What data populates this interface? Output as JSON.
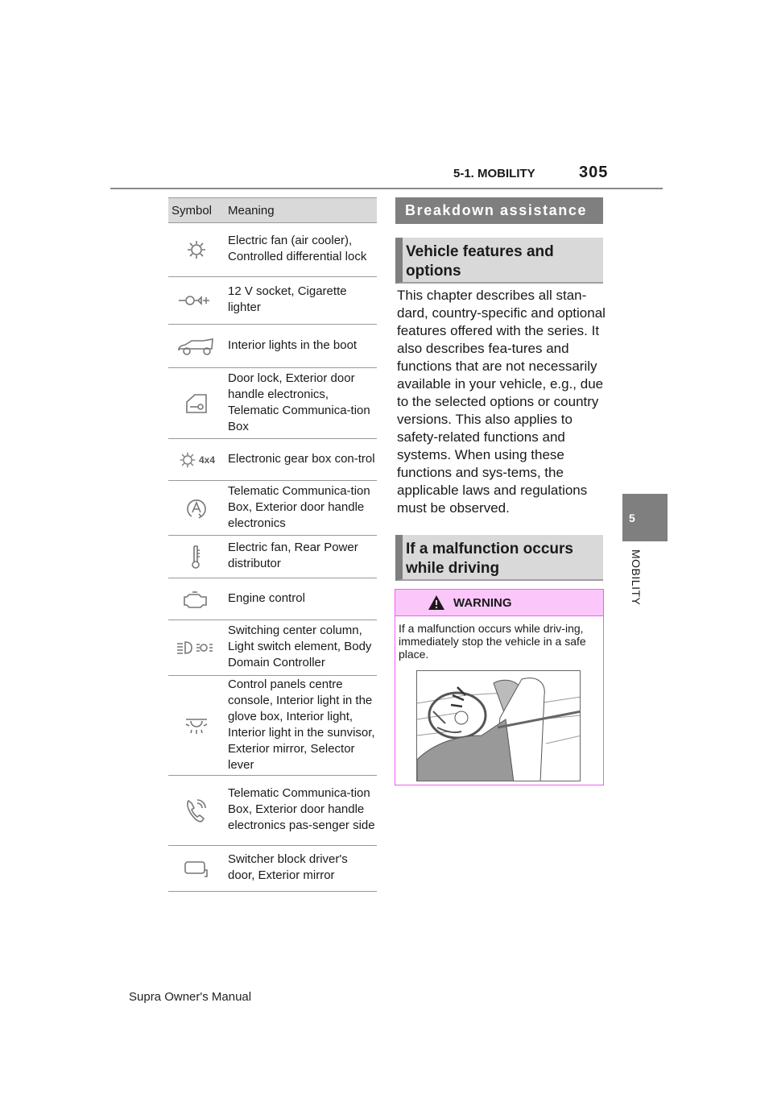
{
  "header": {
    "section": "5-1. MOBILITY",
    "page_number": "305"
  },
  "side_tab": {
    "chapter_number": "5",
    "chapter_label": "MOBILITY"
  },
  "table": {
    "headers": [
      "Symbol",
      "Meaning"
    ],
    "rows": [
      {
        "icon": "gear-icon",
        "meaning": "Electric fan (air cooler), Controlled differential lock"
      },
      {
        "icon": "socket-plug-icon",
        "meaning": "12 V socket, Cigarette lighter"
      },
      {
        "icon": "car-boot-icon",
        "meaning": "Interior lights in the boot"
      },
      {
        "icon": "door-key-icon",
        "meaning": "Door lock, Exterior door handle electronics, Telematic Communica-tion Box"
      },
      {
        "icon": "gear-4x4-icon",
        "icon_text": "4x4",
        "meaning": "Electronic gear box con-trol"
      },
      {
        "icon": "auto-a-icon",
        "icon_text": "A",
        "meaning": "Telematic Communica-tion Box, Exterior door handle electronics"
      },
      {
        "icon": "thermometer-icon",
        "meaning": "Electric fan, Rear Power distributor"
      },
      {
        "icon": "engine-icon",
        "meaning": "Engine control"
      },
      {
        "icon": "headlight-icon",
        "meaning": "Switching center column, Light switch element, Body Domain Controller"
      },
      {
        "icon": "interior-light-icon",
        "meaning": "Control panels centre console, Interior light in the glove box, Interior light, Interior light in the sunvisor, Exterior mirror, Selector lever"
      },
      {
        "icon": "phone-icon",
        "meaning": "Telematic Communica-tion Box, Exterior door handle electronics pas-senger side"
      },
      {
        "icon": "mirror-icon",
        "meaning": "Switcher block driver's door, Exterior mirror"
      }
    ]
  },
  "right": {
    "banner": "Breakdown assistance",
    "subhead1": "Vehicle features and options",
    "body": "This chapter describes all stan-dard, country-specific and optional features offered with the series. It also describes fea-tures and functions that are not necessarily available in your vehicle, e.g., due to the selected options or country versions. This also applies to safety-related functions and systems. When using these functions and sys-tems, the applicable laws and regulations must be observed.",
    "subhead2": "If a malfunction occurs while driving",
    "warning": {
      "title": "WARNING",
      "text": "If a malfunction occurs while driv-ing, immediately stop the vehicle in a safe place."
    }
  },
  "footer": "Supra Owner's Manual"
}
